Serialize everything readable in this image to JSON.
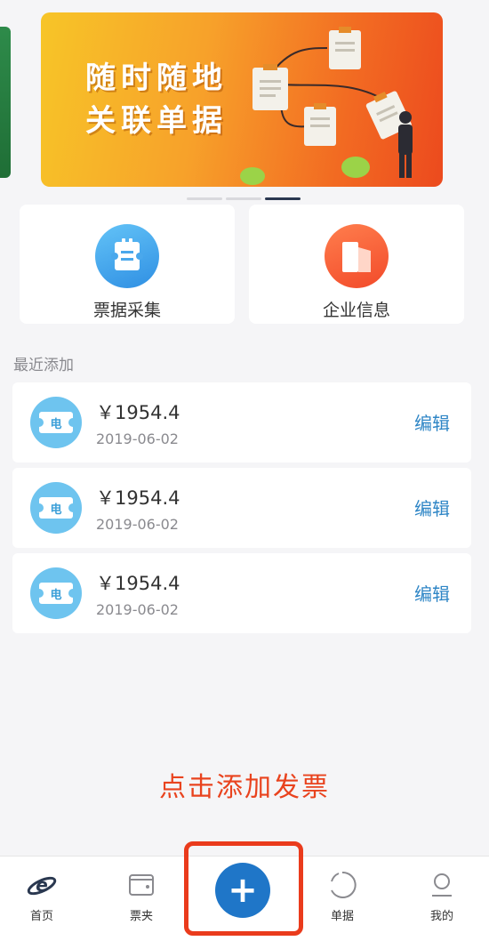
{
  "banner": {
    "title_line1": "随时随地",
    "title_line2": "关联单据"
  },
  "quick_actions": [
    {
      "label": "票据采集",
      "icon": "ticket-collect-icon",
      "color": "#3a9be8"
    },
    {
      "label": "企业信息",
      "icon": "enterprise-info-icon",
      "color": "#f4522c"
    }
  ],
  "recent": {
    "title": "最近添加",
    "items": [
      {
        "badge": "电",
        "amount": "￥1954.4",
        "date": "2019-06-02",
        "edit": "编辑"
      },
      {
        "badge": "电",
        "amount": "￥1954.4",
        "date": "2019-06-02",
        "edit": "编辑"
      },
      {
        "badge": "电",
        "amount": "￥1954.4",
        "date": "2019-06-02",
        "edit": "编辑"
      }
    ]
  },
  "hint": "点击添加发票",
  "tabbar": {
    "tabs": [
      {
        "label": "首页",
        "icon": "home-icon"
      },
      {
        "label": "票夹",
        "icon": "wallet-icon"
      },
      {
        "label": "",
        "icon": "add-icon"
      },
      {
        "label": "单据",
        "icon": "receipts-icon"
      },
      {
        "label": "我的",
        "icon": "profile-icon"
      }
    ]
  },
  "colors": {
    "accent_blue": "#1f76c8",
    "edit_blue": "#2f86c6",
    "highlight_red": "#ea3b1c"
  }
}
